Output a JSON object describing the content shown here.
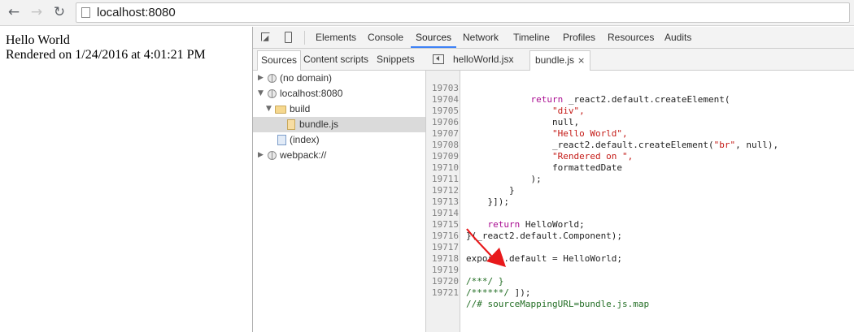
{
  "browser": {
    "back_icon": "arrow-left-icon",
    "forward_icon": "arrow-right-icon",
    "reload_icon": "reload-icon",
    "url": "localhost:8080"
  },
  "page": {
    "line1": "Hello World",
    "line2": "Rendered on 1/24/2016 at 4:01:21 PM"
  },
  "devtools": {
    "tabs": [
      "Elements",
      "Console",
      "Sources",
      "Network",
      "Timeline",
      "Profiles",
      "Resources",
      "Audits"
    ],
    "active_tab": "Sources",
    "accent_color": "#3e82f7",
    "navigator_tabs": [
      "Sources",
      "Content scripts",
      "Snippets"
    ],
    "tree": [
      {
        "label": "(no domain)",
        "icon": "globe-icon"
      },
      {
        "label": "localhost:8080",
        "icon": "globe-icon"
      },
      {
        "label": "build",
        "icon": "folder-icon"
      },
      {
        "label": "bundle.js",
        "icon": "js-file-icon"
      },
      {
        "label": "(index)",
        "icon": "html-file-icon"
      },
      {
        "label": "webpack://",
        "icon": "globe-icon"
      }
    ],
    "editor_tabs": [
      "helloWorld.jsx",
      "bundle.js"
    ],
    "active_editor_tab": "bundle.js",
    "close_glyph": "×"
  },
  "code": {
    "lines": [
      {
        "n": "19703",
        "text": "            return _react2.default.createElement("
      },
      {
        "n": "19704",
        "text": "                \"div\","
      },
      {
        "n": "19705",
        "text": "                null,"
      },
      {
        "n": "19706",
        "text": "                \"Hello World\","
      },
      {
        "n": "19707",
        "text": "                _react2.default.createElement(\"br\", null),"
      },
      {
        "n": "19708",
        "text": "                \"Rendered on \","
      },
      {
        "n": "19709",
        "text": "                formattedDate"
      },
      {
        "n": "19710",
        "text": "            );"
      },
      {
        "n": "19711",
        "text": "        }"
      },
      {
        "n": "19712",
        "text": "    }]);"
      },
      {
        "n": "19713",
        "text": ""
      },
      {
        "n": "19714",
        "text": "    return HelloWorld;"
      },
      {
        "n": "19715",
        "text": "}(_react2.default.Component);"
      },
      {
        "n": "19716",
        "text": ""
      },
      {
        "n": "19717",
        "text": "exports.default = HelloWorld;"
      },
      {
        "n": "19718",
        "text": ""
      },
      {
        "n": "19719",
        "text": "/***/ }"
      },
      {
        "n": "19720",
        "text": "/******/ ]);"
      },
      {
        "n": "19721",
        "text": "//# sourceMappingURL=bundle.js.map"
      }
    ]
  },
  "annotation": {
    "arrow_color": "#e8191b"
  }
}
